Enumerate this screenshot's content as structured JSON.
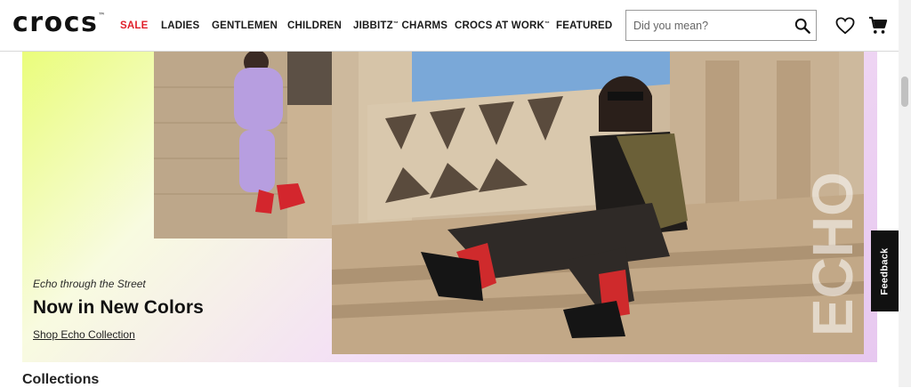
{
  "brand": {
    "logo_text": "crocs",
    "logo_mark": "™"
  },
  "nav": {
    "items": [
      {
        "label": "SALE",
        "trademark": ""
      },
      {
        "label": "LADIES",
        "trademark": ""
      },
      {
        "label": "GENTLEMEN",
        "trademark": ""
      },
      {
        "label": "CHILDREN",
        "trademark": ""
      },
      {
        "label": "JIBBITZ",
        "trademark": "™",
        "suffix": " CHARMS"
      },
      {
        "label": "CROCS AT WORK",
        "trademark": "™",
        "suffix": ""
      },
      {
        "label": "FEATURED",
        "trademark": ""
      }
    ],
    "highlight_color": "#e0202b"
  },
  "search": {
    "placeholder": "Did you mean?",
    "value": "",
    "icon": "search-icon"
  },
  "header_icons": [
    "heart-icon",
    "cart-icon"
  ],
  "hero": {
    "eyebrow": "Echo through the Street",
    "headline": "Now in New Colors",
    "cta_label": "Shop Echo Collection",
    "watermark_text": "ECHO"
  },
  "feedback": {
    "label": "Feedback"
  },
  "collections": {
    "title": "Collections"
  }
}
